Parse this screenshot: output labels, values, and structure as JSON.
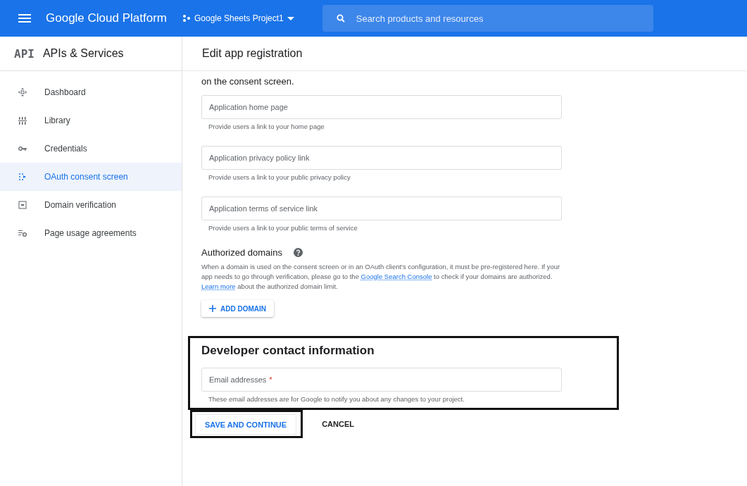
{
  "header": {
    "title": "Google Cloud Platform",
    "project": "Google Sheets Project1",
    "search": {
      "placeholder": "Search products and resources"
    }
  },
  "sidebar": {
    "logo": "API",
    "title": "APIs & Services",
    "items": [
      {
        "label": "Dashboard",
        "selected": false
      },
      {
        "label": "Library",
        "selected": false
      },
      {
        "label": "Credentials",
        "selected": false
      },
      {
        "label": "OAuth consent screen",
        "selected": true
      },
      {
        "label": "Domain verification",
        "selected": false
      },
      {
        "label": "Page usage agreements",
        "selected": false
      }
    ]
  },
  "page": {
    "title": "Edit app registration",
    "intro": "on the consent screen.",
    "fields": [
      {
        "placeholder": "Application home page",
        "hint": "Provide users a link to your home page"
      },
      {
        "placeholder": "Application privacy policy link",
        "hint": "Provide users a link to your public privacy policy"
      },
      {
        "placeholder": "Application terms of service link",
        "hint": "Provide users a link to your public terms of service"
      }
    ],
    "authorized_domains": {
      "title": "Authorized domains",
      "paragraph": [
        {
          "kind": "text",
          "text": "When a domain is used on the consent screen or in an OAuth client's configuration, it must be pre-registered here. If your app needs to go through verification, please go to the "
        },
        {
          "kind": "link",
          "text": "Google Search Console"
        },
        {
          "kind": "text",
          "text": " to check if your domains are authorized. "
        },
        {
          "kind": "link",
          "text": "Learn more"
        },
        {
          "kind": "text",
          "text": " about the authorized domain limit."
        }
      ],
      "add_button": "ADD DOMAIN"
    },
    "developer_contact": {
      "title": "Developer contact information",
      "field": {
        "placeholder": "Email addresses",
        "required_mark": "*",
        "hint": "These email addresses are for Google to notify you about any changes to your project."
      }
    },
    "buttons": [
      {
        "label": "SAVE AND CONTINUE",
        "kind": "primary"
      },
      {
        "label": "CANCEL",
        "kind": "text"
      }
    ]
  }
}
